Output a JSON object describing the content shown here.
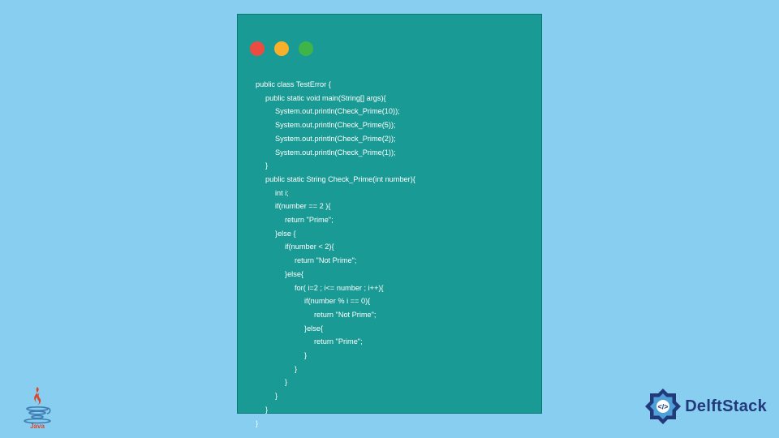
{
  "code": {
    "lines": [
      {
        "indent": 0,
        "text": "public class TestError {"
      },
      {
        "indent": 1,
        "text": "public static void main(String[] args){"
      },
      {
        "indent": 2,
        "text": "System.out.println(Check_Prime(10));"
      },
      {
        "indent": 2,
        "text": "System.out.println(Check_Prime(5));"
      },
      {
        "indent": 2,
        "text": "System.out.println(Check_Prime(2));"
      },
      {
        "indent": 2,
        "text": "System.out.println(Check_Prime(1));"
      },
      {
        "indent": 1,
        "text": "}"
      },
      {
        "indent": 1,
        "text": "public static String Check_Prime(int number){"
      },
      {
        "indent": 2,
        "text": "int i;"
      },
      {
        "indent": 2,
        "text": "if(number == 2 ){"
      },
      {
        "indent": 3,
        "text": "return \"Prime\";"
      },
      {
        "indent": 2,
        "text": "}else {"
      },
      {
        "indent": 3,
        "text": "if(number < 2){"
      },
      {
        "indent": 4,
        "text": "return \"Not Prime\";"
      },
      {
        "indent": 3,
        "text": "}else{"
      },
      {
        "indent": 4,
        "text": "for( i=2 ; i<= number ; i++){"
      },
      {
        "indent": 5,
        "text": "if(number % i == 0){"
      },
      {
        "indent": 6,
        "text": "return \"Not Prime\";"
      },
      {
        "indent": 5,
        "text": "}else{"
      },
      {
        "indent": 6,
        "text": "return \"Prime\";"
      },
      {
        "indent": 5,
        "text": "}"
      },
      {
        "indent": 4,
        "text": "}"
      },
      {
        "indent": 3,
        "text": "}"
      },
      {
        "indent": 2,
        "text": "}"
      },
      {
        "indent": 1,
        "text": "}"
      },
      {
        "indent": 0,
        "text": "}"
      }
    ]
  },
  "logos": {
    "java": "Java",
    "delft": "DelftStack"
  },
  "colors": {
    "bg": "#87cef0",
    "window": "#1a9a94",
    "red": "#eb4c42",
    "yellow": "#f8b02b",
    "green": "#3fb549",
    "delft_blue": "#223a7a"
  }
}
